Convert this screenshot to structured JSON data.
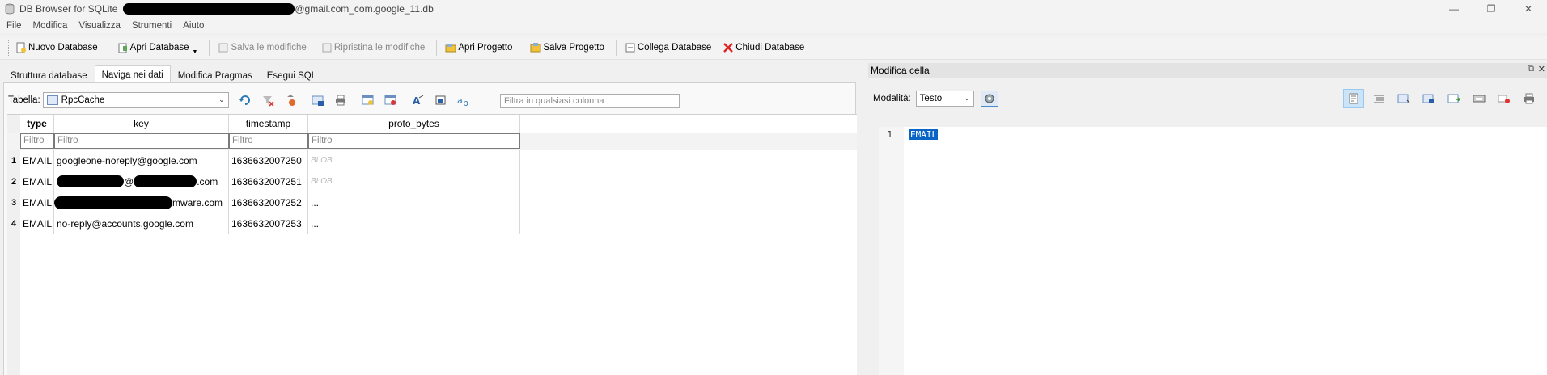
{
  "window": {
    "app_title": "DB Browser for SQLite",
    "file_suffix": "@gmail.com_com.google_11.db",
    "controls": {
      "minimize": "—",
      "restore": "❐",
      "close": "✕"
    }
  },
  "menu": [
    "File",
    "Modifica",
    "Visualizza",
    "Strumenti",
    "Aiuto"
  ],
  "toolbar": {
    "new_db": "Nuovo Database",
    "open_db": "Apri Database",
    "write_changes": "Salva le modifiche",
    "revert_changes": "Ripristina le modifiche",
    "open_project": "Apri Progetto",
    "save_project": "Salva Progetto",
    "attach_db": "Collega Database",
    "close_db": "Chiudi Database"
  },
  "tabs": [
    {
      "label": "Struttura database",
      "active": false
    },
    {
      "label": "Naviga nei dati",
      "active": true
    },
    {
      "label": "Modifica Pragmas",
      "active": false
    },
    {
      "label": "Esegui SQL",
      "active": false
    }
  ],
  "browse": {
    "table_label": "Tabella:",
    "table_value": "RpcCache",
    "filter_all_placeholder": "Filtra in qualsiasi colonna",
    "columns": [
      "type",
      "key",
      "timestamp",
      "proto_bytes"
    ],
    "filter_placeholder": "Filtro",
    "rows": [
      {
        "num": "1",
        "type": "EMAIL",
        "key": "googleone-noreply@google.com",
        "timestamp": "1636632007250",
        "proto": "BLOB"
      },
      {
        "num": "2",
        "type": "EMAIL",
        "key_at": "@",
        "key_tail": ".com",
        "timestamp": "1636632007251",
        "proto": "BLOB"
      },
      {
        "num": "3",
        "type": "EMAIL",
        "key_tail": "mware.com",
        "timestamp": "1636632007252",
        "proto": "..."
      },
      {
        "num": "4",
        "type": "EMAIL",
        "key": "no-reply@accounts.google.com",
        "timestamp": "1636632007253",
        "proto": "..."
      }
    ]
  },
  "edit_cell": {
    "title": "Modifica cella",
    "mode_label": "Modalità:",
    "mode_value": "Testo",
    "line_number": "1",
    "content": "EMAIL",
    "float_icon": "⧉",
    "close_icon": "✕"
  }
}
